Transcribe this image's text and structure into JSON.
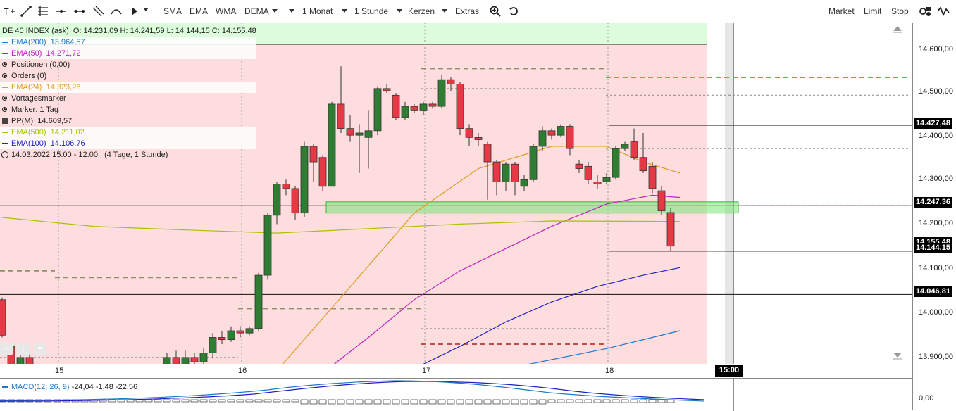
{
  "toolbar": {
    "buttons": [
      {
        "label": "SMA"
      },
      {
        "label": "EMA"
      },
      {
        "label": "WMA"
      },
      {
        "label": "DEMA"
      }
    ],
    "interval": "1 Monat",
    "granularity": "1 Stunde",
    "chart_type": "Kerzen",
    "extras": "Extras",
    "order_buttons": [
      "Market",
      "Limit",
      "Stop"
    ]
  },
  "legend": {
    "instrument": "DE 40 INDEX (ask)",
    "ohlc": "O: 14.231,09  H: 14.241,59  L: 14.144,15  C: 14.155,48",
    "items": [
      {
        "type": "line",
        "color": "#1f77c8",
        "name": "EMA(200)",
        "value": "13.964,57"
      },
      {
        "type": "line",
        "color": "#c020c0",
        "name": "EMA(50)",
        "value": "14.271,72"
      },
      {
        "type": "radio",
        "text": "Positionen (0,00)"
      },
      {
        "type": "radio",
        "text": "Orders (0)"
      },
      {
        "type": "line",
        "color": "#e09a1e",
        "name": "EMA(24)",
        "value": "14.323,28"
      },
      {
        "type": "radio",
        "text": "Vortagesmarker"
      },
      {
        "type": "radio",
        "text": "Marker: 1 Tag"
      },
      {
        "type": "square",
        "name": "PP(M)",
        "value": "14.609,57"
      },
      {
        "type": "line",
        "color": "#a6c400",
        "name": "EMA(500)",
        "value": "14.211,02"
      },
      {
        "type": "line",
        "color": "#2020c8",
        "name": "EMA(100)",
        "value": "14.106,76"
      }
    ],
    "period": "14.03.2022 15:00 - 12:00",
    "period_note": "(4 Tage, 1 Stunde)"
  },
  "price_axis": {
    "ticks": [
      "14.600,00",
      "14.500,00",
      "14.400,00",
      "14.300,00",
      "14.200,00",
      "14.100,00",
      "14.000,00",
      "13.900,00"
    ],
    "labels": [
      "14.427,48",
      "14.247,36",
      "14.155,48",
      "14.144,15",
      "14.046,81"
    ]
  },
  "date_axis": {
    "labels": [
      "15",
      "16",
      "17",
      "18"
    ],
    "current_time": "15:00"
  },
  "macd": {
    "name": "MACD(12, 26, 9)",
    "values": "-24,04  -1,48  -22,56",
    "color": "#1f77c8",
    "axis_label": "0,00"
  },
  "chart_data": {
    "type": "candlestick",
    "instrument": "DE 40 INDEX (ask)",
    "timeframe": "1 Stunde",
    "ylim": [
      13885,
      14650
    ],
    "candles": [
      {
        "o": 14035,
        "c": 13955,
        "h": 14040,
        "l": 13950
      },
      {
        "o": 13930,
        "c": 13880,
        "h": 13935,
        "l": 13870
      },
      {
        "o": 13880,
        "c": 13905,
        "h": 13910,
        "l": 13875
      },
      {
        "o": 13905,
        "c": 13880,
        "h": 13912,
        "l": 13875
      },
      {
        "o": 13880,
        "c": 13880,
        "h": 13888,
        "l": 13876
      },
      {
        "o": 13880,
        "c": 13882,
        "h": 13885,
        "l": 13878
      },
      {
        "o": 13882,
        "c": 13880,
        "h": 13885,
        "l": 13877
      },
      {
        "o": 13880,
        "c": 13880,
        "h": 13884,
        "l": 13876
      },
      {
        "o": 13880,
        "c": 13878,
        "h": 13885,
        "l": 13874
      },
      {
        "o": 13878,
        "c": 13880,
        "h": 13884,
        "l": 13875
      },
      {
        "o": 13880,
        "c": 13880,
        "h": 13885,
        "l": 13876
      },
      {
        "o": 13880,
        "c": 13880,
        "h": 13884,
        "l": 13876
      },
      {
        "o": 13880,
        "c": 13880,
        "h": 13884,
        "l": 13876
      },
      {
        "o": 13880,
        "c": 13880,
        "h": 13884,
        "l": 13876
      },
      {
        "o": 13880,
        "c": 13880,
        "h": 13884,
        "l": 13876
      },
      {
        "o": 13880,
        "c": 13880,
        "h": 13884,
        "l": 13876
      },
      {
        "o": 13880,
        "c": 13880,
        "h": 13884,
        "l": 13876
      },
      {
        "o": 13880,
        "c": 13880,
        "h": 13884,
        "l": 13876
      },
      {
        "o": 13880,
        "c": 13905,
        "h": 13915,
        "l": 13870
      },
      {
        "o": 13905,
        "c": 13890,
        "h": 13920,
        "l": 13885
      },
      {
        "o": 13890,
        "c": 13905,
        "h": 13920,
        "l": 13880
      },
      {
        "o": 13905,
        "c": 13895,
        "h": 13915,
        "l": 13885
      },
      {
        "o": 13895,
        "c": 13915,
        "h": 13925,
        "l": 13890
      },
      {
        "o": 13915,
        "c": 13950,
        "h": 13960,
        "l": 13905
      },
      {
        "o": 13950,
        "c": 13945,
        "h": 13965,
        "l": 13935
      },
      {
        "o": 13945,
        "c": 13965,
        "h": 13975,
        "l": 13940
      },
      {
        "o": 13965,
        "c": 13960,
        "h": 13975,
        "l": 13950
      },
      {
        "o": 13960,
        "c": 13970,
        "h": 13975,
        "l": 13955
      },
      {
        "o": 13970,
        "c": 14090,
        "h": 14095,
        "l": 13965
      },
      {
        "o": 14090,
        "c": 14225,
        "h": 14230,
        "l": 14080
      },
      {
        "o": 14225,
        "c": 14295,
        "h": 14300,
        "l": 14205
      },
      {
        "o": 14295,
        "c": 14285,
        "h": 14305,
        "l": 14270
      },
      {
        "o": 14285,
        "c": 14230,
        "h": 14290,
        "l": 14215
      },
      {
        "o": 14230,
        "c": 14380,
        "h": 14390,
        "l": 14220
      },
      {
        "o": 14380,
        "c": 14345,
        "h": 14385,
        "l": 14300
      },
      {
        "o": 14355,
        "c": 14290,
        "h": 14360,
        "l": 14280
      },
      {
        "o": 14290,
        "c": 14475,
        "h": 14480,
        "l": 14290
      },
      {
        "o": 14475,
        "c": 14420,
        "h": 14560,
        "l": 14410
      },
      {
        "o": 14420,
        "c": 14405,
        "h": 14450,
        "l": 14390
      },
      {
        "o": 14405,
        "c": 14410,
        "h": 14430,
        "l": 14320
      },
      {
        "o": 14400,
        "c": 14415,
        "h": 14460,
        "l": 14330
      },
      {
        "o": 14415,
        "c": 14510,
        "h": 14515,
        "l": 14405
      },
      {
        "o": 14510,
        "c": 14505,
        "h": 14520,
        "l": 14500
      },
      {
        "o": 14495,
        "c": 14445,
        "h": 14500,
        "l": 14440
      },
      {
        "o": 14445,
        "c": 14470,
        "h": 14480,
        "l": 14440
      },
      {
        "o": 14470,
        "c": 14460,
        "h": 14475,
        "l": 14455
      },
      {
        "o": 14460,
        "c": 14475,
        "h": 14480,
        "l": 14450
      },
      {
        "o": 14475,
        "c": 14470,
        "h": 14480,
        "l": 14465
      },
      {
        "o": 14470,
        "c": 14530,
        "h": 14540,
        "l": 14465
      },
      {
        "o": 14530,
        "c": 14520,
        "h": 14535,
        "l": 14505
      },
      {
        "o": 14520,
        "c": 14420,
        "h": 14525,
        "l": 14405
      },
      {
        "o": 14420,
        "c": 14400,
        "h": 14430,
        "l": 14380
      },
      {
        "o": 14400,
        "c": 14395,
        "h": 14410,
        "l": 14380
      },
      {
        "o": 14385,
        "c": 14345,
        "h": 14390,
        "l": 14260
      },
      {
        "o": 14345,
        "c": 14300,
        "h": 14350,
        "l": 14270
      },
      {
        "o": 14300,
        "c": 14340,
        "h": 14345,
        "l": 14280
      },
      {
        "o": 14340,
        "c": 14300,
        "h": 14345,
        "l": 14270
      },
      {
        "o": 14290,
        "c": 14305,
        "h": 14315,
        "l": 14280
      },
      {
        "o": 14305,
        "c": 14380,
        "h": 14385,
        "l": 14300
      },
      {
        "o": 14380,
        "c": 14415,
        "h": 14425,
        "l": 14370
      },
      {
        "o": 14415,
        "c": 14405,
        "h": 14420,
        "l": 14395
      },
      {
        "o": 14405,
        "c": 14425,
        "h": 14430,
        "l": 14400
      },
      {
        "o": 14425,
        "c": 14375,
        "h": 14430,
        "l": 14360
      },
      {
        "o": 14340,
        "c": 14330,
        "h": 14350,
        "l": 14320
      },
      {
        "o": 14335,
        "c": 14305,
        "h": 14345,
        "l": 14295
      },
      {
        "o": 14300,
        "c": 14295,
        "h": 14315,
        "l": 14285
      },
      {
        "o": 14300,
        "c": 14310,
        "h": 14320,
        "l": 14295
      },
      {
        "o": 14310,
        "c": 14375,
        "h": 14380,
        "l": 14305
      },
      {
        "o": 14375,
        "c": 14385,
        "h": 14390,
        "l": 14370
      },
      {
        "o": 14390,
        "c": 14355,
        "h": 14420,
        "l": 14350
      },
      {
        "o": 14355,
        "c": 14325,
        "h": 14410,
        "l": 14320
      },
      {
        "o": 14335,
        "c": 14285,
        "h": 14345,
        "l": 14275
      },
      {
        "o": 14280,
        "c": 14235,
        "h": 14290,
        "l": 14225
      },
      {
        "o": 14231.09,
        "c": 14155.48,
        "h": 14241.59,
        "l": 14144.15
      }
    ],
    "reference_levels": [
      14427.48,
      14247.36,
      14144.15,
      14046.81
    ],
    "zone": {
      "low": 14230,
      "high": 14255
    },
    "pivot_lines": [
      {
        "y": 14555,
        "style": "dashed",
        "color": "#8f8f6a"
      },
      {
        "y": 14535,
        "style": "dashed",
        "color": "#50c050"
      },
      {
        "y": 14510,
        "style": "dotted",
        "color": "#888888"
      },
      {
        "y": 14495,
        "style": "dotted",
        "color": "#888888"
      },
      {
        "y": 14375,
        "style": "dotted",
        "color": "#888888"
      },
      {
        "y": 14100,
        "style": "dashed",
        "color": "#8f8f6a"
      },
      {
        "y": 14085,
        "style": "dashed",
        "color": "#8f8f6a"
      },
      {
        "y": 14015,
        "style": "dashed",
        "color": "#8f8f6a"
      },
      {
        "y": 13970,
        "style": "dotted",
        "color": "#888888"
      },
      {
        "y": 13935,
        "style": "dashed",
        "color": "#c05050"
      },
      {
        "y": 13905,
        "style": "dotted",
        "color": "#888888"
      }
    ],
    "emas": [
      {
        "name": "EMA(24)",
        "color": "#e09a1e",
        "points": [
          [
            30,
            13875
          ],
          [
            37,
            14040
          ],
          [
            45,
            14230
          ],
          [
            52,
            14330
          ],
          [
            60,
            14380
          ],
          [
            66,
            14380
          ],
          [
            70,
            14345
          ],
          [
            74,
            14320
          ]
        ]
      },
      {
        "name": "EMA(50)",
        "color": "#c020c0",
        "points": [
          [
            35,
            13870
          ],
          [
            40,
            13950
          ],
          [
            45,
            14035
          ],
          [
            50,
            14100
          ],
          [
            55,
            14150
          ],
          [
            60,
            14200
          ],
          [
            66,
            14250
          ],
          [
            71,
            14270
          ],
          [
            74,
            14265
          ]
        ]
      },
      {
        "name": "EMA(100)",
        "color": "#2020c8",
        "points": [
          [
            45,
            13880
          ],
          [
            50,
            13930
          ],
          [
            55,
            13985
          ],
          [
            60,
            14030
          ],
          [
            65,
            14065
          ],
          [
            70,
            14090
          ],
          [
            74,
            14107
          ]
        ]
      },
      {
        "name": "EMA(200)",
        "color": "#1f77c8",
        "points": [
          [
            54,
            13875
          ],
          [
            60,
            13900
          ],
          [
            66,
            13925
          ],
          [
            71,
            13950
          ],
          [
            74,
            13965
          ]
        ]
      },
      {
        "name": "EMA(500)",
        "color": "#a6c400",
        "points": [
          [
            0,
            14220
          ],
          [
            10,
            14200
          ],
          [
            20,
            14192
          ],
          [
            30,
            14185
          ],
          [
            40,
            14195
          ],
          [
            50,
            14205
          ],
          [
            60,
            14212
          ],
          [
            74,
            14211
          ]
        ]
      }
    ]
  }
}
